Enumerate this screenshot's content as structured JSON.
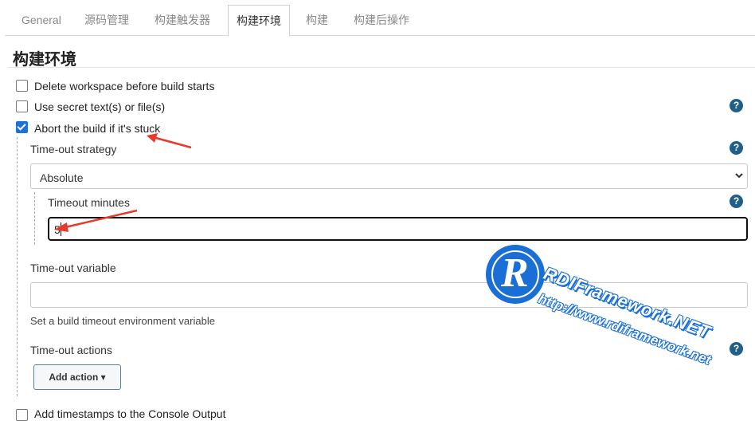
{
  "tabs": [
    {
      "label": "General"
    },
    {
      "label": "源码管理"
    },
    {
      "label": "构建触发器"
    },
    {
      "label": "构建环境"
    },
    {
      "label": "构建"
    },
    {
      "label": "构建后操作"
    }
  ],
  "active_tab": "构建环境",
  "section": {
    "title": "构建环境"
  },
  "options": {
    "delete_workspace": {
      "label": "Delete workspace before build starts",
      "checked": false
    },
    "secret_text": {
      "label": "Use secret text(s) or file(s)",
      "checked": false
    },
    "abort_stuck": {
      "label": "Abort the build if it's stuck",
      "checked": true
    },
    "timestamps": {
      "label": "Add timestamps to the Console Output",
      "checked": false
    }
  },
  "timeout": {
    "strategy_label": "Time-out strategy",
    "strategy_value": "Absolute",
    "minutes_label": "Timeout minutes",
    "minutes_value": "5",
    "variable_label": "Time-out variable",
    "variable_value": "",
    "variable_hint": "Set a build timeout environment variable",
    "actions_label": "Time-out actions",
    "add_action_label": "Add action ▾"
  },
  "help_glyph": "?",
  "watermark": {
    "logo_letter": "R",
    "name": "RDIFramework.NET",
    "url": "http://www.rdiframework.net"
  },
  "colors": {
    "accent": "#1b73d9",
    "help": "#1f5f8a",
    "arrow": "#e53a2c",
    "watermark": "#1a6fd6"
  }
}
